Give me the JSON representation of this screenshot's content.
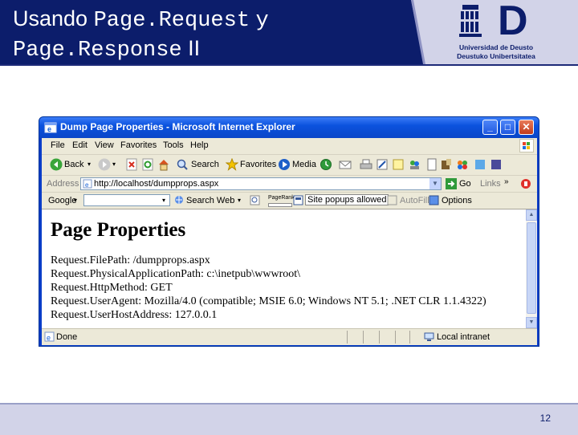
{
  "slide": {
    "title_word": "Usando",
    "title_code1": "Page.Request",
    "title_conj": "y",
    "title_code2": "Page.Response",
    "title_suffix": "II",
    "logo_letter": "D",
    "logo_line1": "Universidad de Deusto",
    "logo_line2": "Deustuko Unibertsitatea",
    "page_number": "12"
  },
  "browser": {
    "window_title": "Dump Page Properties - Microsoft Internet Explorer",
    "menu": [
      "File",
      "Edit",
      "View",
      "Favorites",
      "Tools",
      "Help"
    ],
    "toolbar": {
      "back": "Back",
      "search": "Search",
      "favorites": "Favorites",
      "media": "Media"
    },
    "address": {
      "label": "Address",
      "url": "http://localhost/dumpprops.aspx",
      "go": "Go",
      "links": "Links"
    },
    "google_bar": {
      "brand": "Google",
      "search_web": "Search Web",
      "pagerank": "PageRank",
      "popups": "Site popups allowed",
      "autofill": "AutoFill",
      "options": "Options"
    },
    "content": {
      "heading": "Page Properties",
      "lines": [
        "Request.FilePath: /dumpprops.aspx",
        "Request.PhysicalApplicationPath: c:\\inetpub\\wwwroot\\",
        "Request.HttpMethod: GET",
        "Request.UserAgent: Mozilla/4.0 (compatible; MSIE 6.0; Windows NT 5.1; .NET CLR 1.1.4322)",
        "Request.UserHostAddress: 127.0.0.1"
      ]
    },
    "status": {
      "text": "Done",
      "zone": "Local intranet"
    }
  },
  "colors": {
    "title_bg": "#0c1d6b",
    "header_bg": "#d2d3e8",
    "xp_titlebar": "#0b52de"
  }
}
